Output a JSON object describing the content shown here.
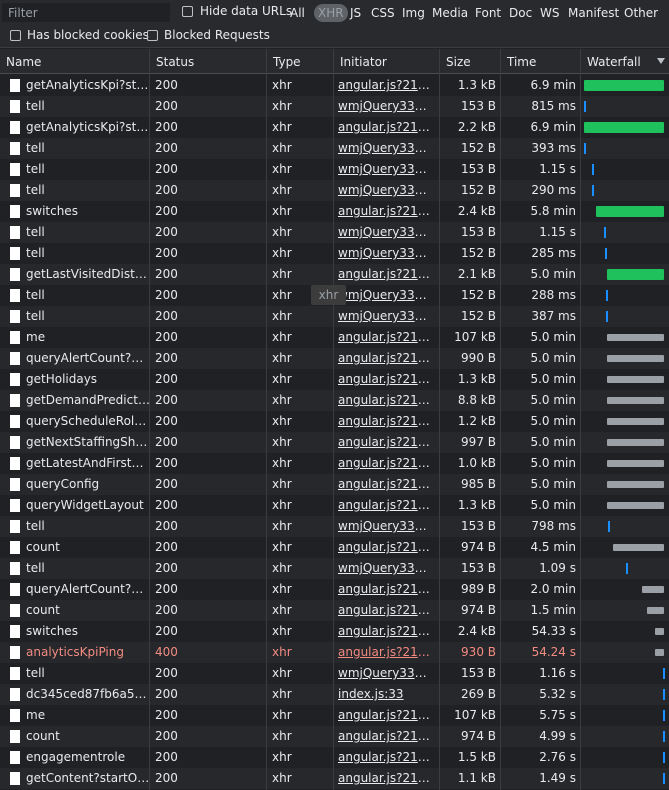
{
  "toolbar": {
    "filter_placeholder": "Filter",
    "hide_data_urls": "Hide data URLs",
    "types": [
      "All",
      "XHR",
      "JS",
      "CSS",
      "Img",
      "Media",
      "Font",
      "Doc",
      "WS",
      "Manifest",
      "Other"
    ],
    "active_type": "XHR",
    "has_blocked_cookies": "Has blocked cookies",
    "blocked_requests": "Blocked Requests"
  },
  "columns": {
    "name": "Name",
    "status": "Status",
    "type": "Type",
    "initiator": "Initiator",
    "size": "Size",
    "time": "Time",
    "waterfall": "Waterfall"
  },
  "tooltip": "xhr",
  "colors": {
    "accent_green": "#1fc15c",
    "error_red": "#f28b82",
    "link_blue": "#1a8fff"
  },
  "requests": [
    {
      "name": "getAnalyticsKpi?start...",
      "status": "200",
      "type": "xhr",
      "initiator": "angular.js?21b1:...",
      "size": "1.3 kB",
      "time": "6.9 min",
      "wf": {
        "kind": "green",
        "start": 0.02,
        "end": 0.97
      }
    },
    {
      "name": "tell",
      "status": "200",
      "type": "xhr",
      "initiator": "wmjQuery3315.j...",
      "size": "153 B",
      "time": "815 ms",
      "wf": {
        "kind": "blue",
        "start": 0.02,
        "end": 0.04
      }
    },
    {
      "name": "getAnalyticsKpi?start...",
      "status": "200",
      "type": "xhr",
      "initiator": "angular.js?21b1:...",
      "size": "2.2 kB",
      "time": "6.9 min",
      "wf": {
        "kind": "green",
        "start": 0.02,
        "end": 0.97
      }
    },
    {
      "name": "tell",
      "status": "200",
      "type": "xhr",
      "initiator": "wmjQuery3315.j...",
      "size": "152 B",
      "time": "393 ms",
      "wf": {
        "kind": "blue",
        "start": 0.02,
        "end": 0.04
      }
    },
    {
      "name": "tell",
      "status": "200",
      "type": "xhr",
      "initiator": "wmjQuery3315.j...",
      "size": "153 B",
      "time": "1.15 s",
      "wf": {
        "kind": "blue",
        "start": 0.12,
        "end": 0.14
      }
    },
    {
      "name": "tell",
      "status": "200",
      "type": "xhr",
      "initiator": "wmjQuery3315.j...",
      "size": "152 B",
      "time": "290 ms",
      "wf": {
        "kind": "blue",
        "start": 0.12,
        "end": 0.14
      }
    },
    {
      "name": "switches",
      "status": "200",
      "type": "xhr",
      "initiator": "angular.js?21b1:...",
      "size": "2.4 kB",
      "time": "5.8 min",
      "wf": {
        "kind": "green",
        "start": 0.17,
        "end": 0.97
      }
    },
    {
      "name": "tell",
      "status": "200",
      "type": "xhr",
      "initiator": "wmjQuery3315.j...",
      "size": "153 B",
      "time": "1.15 s",
      "wf": {
        "kind": "blue",
        "start": 0.26,
        "end": 0.28
      }
    },
    {
      "name": "tell",
      "status": "200",
      "type": "xhr",
      "initiator": "wmjQuery3315.j...",
      "size": "152 B",
      "time": "285 ms",
      "wf": {
        "kind": "blue",
        "start": 0.27,
        "end": 0.29
      }
    },
    {
      "name": "getLastVisitedDistricts",
      "status": "200",
      "type": "xhr",
      "initiator": "angular.js?21b1:...",
      "size": "2.1 kB",
      "time": "5.0 min",
      "wf": {
        "kind": "green",
        "start": 0.29,
        "end": 0.97
      }
    },
    {
      "name": "tell",
      "status": "200",
      "type": "xhr",
      "initiator": "wmjQuery3315.j...",
      "size": "152 B",
      "time": "288 ms",
      "wf": {
        "kind": "blue",
        "start": 0.28,
        "end": 0.3
      }
    },
    {
      "name": "tell",
      "status": "200",
      "type": "xhr",
      "initiator": "wmjQuery3315.j...",
      "size": "152 B",
      "time": "387 ms",
      "wf": {
        "kind": "blue",
        "start": 0.28,
        "end": 0.3
      }
    },
    {
      "name": "me",
      "status": "200",
      "type": "xhr",
      "initiator": "angular.js?21b1:...",
      "size": "107 kB",
      "time": "5.0 min",
      "wf": {
        "kind": "gray",
        "start": 0.29,
        "end": 0.97
      }
    },
    {
      "name": "queryAlertCount?ent...",
      "status": "200",
      "type": "xhr",
      "initiator": "angular.js?21b1:...",
      "size": "990 B",
      "time": "5.0 min",
      "wf": {
        "kind": "gray",
        "start": 0.29,
        "end": 0.97
      }
    },
    {
      "name": "getHolidays",
      "status": "200",
      "type": "xhr",
      "initiator": "angular.js?21b1:...",
      "size": "1.3 kB",
      "time": "5.0 min",
      "wf": {
        "kind": "gray",
        "start": 0.29,
        "end": 0.97
      }
    },
    {
      "name": "getDemandPredictio...",
      "status": "200",
      "type": "xhr",
      "initiator": "angular.js?21b1:...",
      "size": "8.8 kB",
      "time": "5.0 min",
      "wf": {
        "kind": "gray",
        "start": 0.29,
        "end": 0.97
      }
    },
    {
      "name": "queryScheduleRole...",
      "status": "200",
      "type": "xhr",
      "initiator": "angular.js?21b1:...",
      "size": "1.2 kB",
      "time": "5.0 min",
      "wf": {
        "kind": "gray",
        "start": 0.29,
        "end": 0.97
      }
    },
    {
      "name": "getNextStaffingShift...",
      "status": "200",
      "type": "xhr",
      "initiator": "angular.js?21b1:...",
      "size": "997 B",
      "time": "5.0 min",
      "wf": {
        "kind": "gray",
        "start": 0.29,
        "end": 0.97
      }
    },
    {
      "name": "getLatestAndFirstSch...",
      "status": "200",
      "type": "xhr",
      "initiator": "angular.js?21b1:...",
      "size": "1.0 kB",
      "time": "5.0 min",
      "wf": {
        "kind": "gray",
        "start": 0.29,
        "end": 0.97
      }
    },
    {
      "name": "queryConfig",
      "status": "200",
      "type": "xhr",
      "initiator": "angular.js?21b1:...",
      "size": "985 B",
      "time": "5.0 min",
      "wf": {
        "kind": "gray",
        "start": 0.29,
        "end": 0.97
      }
    },
    {
      "name": "queryWidgetLayout",
      "status": "200",
      "type": "xhr",
      "initiator": "angular.js?21b1:...",
      "size": "1.3 kB",
      "time": "5.0 min",
      "wf": {
        "kind": "gray",
        "start": 0.29,
        "end": 0.97
      }
    },
    {
      "name": "tell",
      "status": "200",
      "type": "xhr",
      "initiator": "wmjQuery3315.j...",
      "size": "153 B",
      "time": "798 ms",
      "wf": {
        "kind": "blue",
        "start": 0.3,
        "end": 0.32
      }
    },
    {
      "name": "count",
      "status": "200",
      "type": "xhr",
      "initiator": "angular.js?21b1:...",
      "size": "974 B",
      "time": "4.5 min",
      "wf": {
        "kind": "gray",
        "start": 0.37,
        "end": 0.97
      }
    },
    {
      "name": "tell",
      "status": "200",
      "type": "xhr",
      "initiator": "wmjQuery3315.j...",
      "size": "153 B",
      "time": "1.09 s",
      "wf": {
        "kind": "blue",
        "start": 0.52,
        "end": 0.54
      }
    },
    {
      "name": "queryAlertCount?ent...",
      "status": "200",
      "type": "xhr",
      "initiator": "angular.js?21b1:...",
      "size": "989 B",
      "time": "2.0 min",
      "wf": {
        "kind": "gray",
        "start": 0.71,
        "end": 0.97
      }
    },
    {
      "name": "count",
      "status": "200",
      "type": "xhr",
      "initiator": "angular.js?21b1:...",
      "size": "974 B",
      "time": "1.5 min",
      "wf": {
        "kind": "gray",
        "start": 0.77,
        "end": 0.97
      }
    },
    {
      "name": "switches",
      "status": "200",
      "type": "xhr",
      "initiator": "angular.js?21b1:...",
      "size": "2.4 kB",
      "time": "54.33 s",
      "wf": {
        "kind": "gray",
        "start": 0.86,
        "end": 0.97
      }
    },
    {
      "name": "analyticsKpiPing",
      "status": "400",
      "type": "xhr",
      "initiator": "angular.js?21b1:...",
      "size": "930 B",
      "time": "54.24 s",
      "error": true,
      "wf": {
        "kind": "gray",
        "start": 0.86,
        "end": 0.97
      }
    },
    {
      "name": "tell",
      "status": "200",
      "type": "xhr",
      "initiator": "wmjQuery3315.j...",
      "size": "153 B",
      "time": "1.16 s",
      "wf": {
        "kind": "blue",
        "start": 0.95,
        "end": 0.97
      }
    },
    {
      "name": "dc345ced87fb6a533...",
      "status": "200",
      "type": "xhr",
      "initiator": "index.js:33",
      "size": "269 B",
      "time": "5.32 s",
      "wf": {
        "kind": "blue",
        "start": 0.95,
        "end": 0.97
      }
    },
    {
      "name": "me",
      "status": "200",
      "type": "xhr",
      "initiator": "angular.js?21b1:...",
      "size": "107 kB",
      "time": "5.75 s",
      "wf": {
        "kind": "blue",
        "start": 0.95,
        "end": 0.97
      }
    },
    {
      "name": "count",
      "status": "200",
      "type": "xhr",
      "initiator": "angular.js?21b1:...",
      "size": "974 B",
      "time": "4.99 s",
      "wf": {
        "kind": "blue",
        "start": 0.95,
        "end": 0.97
      }
    },
    {
      "name": "engagementrole",
      "status": "200",
      "type": "xhr",
      "initiator": "angular.js?21b1:...",
      "size": "1.5 kB",
      "time": "2.76 s",
      "wf": {
        "kind": "blue",
        "start": 0.95,
        "end": 0.97
      }
    },
    {
      "name": "getContent?startOf...",
      "status": "200",
      "type": "xhr",
      "initiator": "angular.js?21b1:...",
      "size": "1.1 kB",
      "time": "1.49 s",
      "wf": {
        "kind": "blue",
        "start": 0.95,
        "end": 0.97
      }
    }
  ]
}
